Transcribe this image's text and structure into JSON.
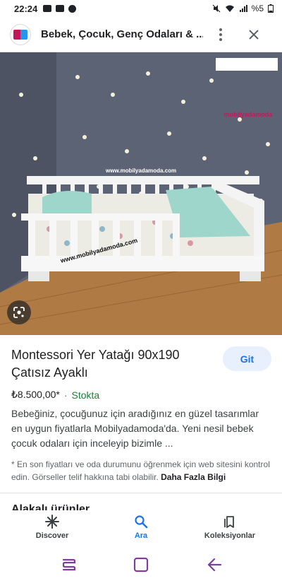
{
  "status_bar": {
    "time": "22:24",
    "battery": "%5"
  },
  "header": {
    "title": "Bebek, Çocuk, Genç Odaları & ...",
    "site_logo_icon": "site-favicon"
  },
  "image": {
    "brand": "mobilyadamoda",
    "watermark": "www.mobilyadamoda.com",
    "watermark2": "www.mobilyadamoda.com"
  },
  "product": {
    "title": "Montessori Yer Yatağı 90x190 Çatısız Ayaklı",
    "visit_label": "Git",
    "price": "₺8.500,00*",
    "separator": "·",
    "stock": "Stokta",
    "description": "Bebeğiniz, çocuğunuz için aradığınız en güzel tasarımlar en uygun fiyatlarla Mobilyadamoda'da. Yeni nesil bebek çocuk odaları için inceleyip bizimle ...",
    "disclaimer": "* En son fiyatları ve oda durumunu öğrenmek için web sitesini kontrol edin. Görseller telif hakkına tabi olabilir.",
    "more_info": "Daha Fazla Bilgi",
    "related_heading": "Alakalı ürünler"
  },
  "bottom_nav": {
    "items": [
      {
        "label": "Discover",
        "icon": "asterisk-icon"
      },
      {
        "label": "Ara",
        "icon": "search-icon"
      },
      {
        "label": "Koleksiyonlar",
        "icon": "collections-icon"
      }
    ]
  },
  "colors": {
    "accent": "#1a73e8",
    "stock": "#188038",
    "system_nav": "#7b3fa0"
  }
}
